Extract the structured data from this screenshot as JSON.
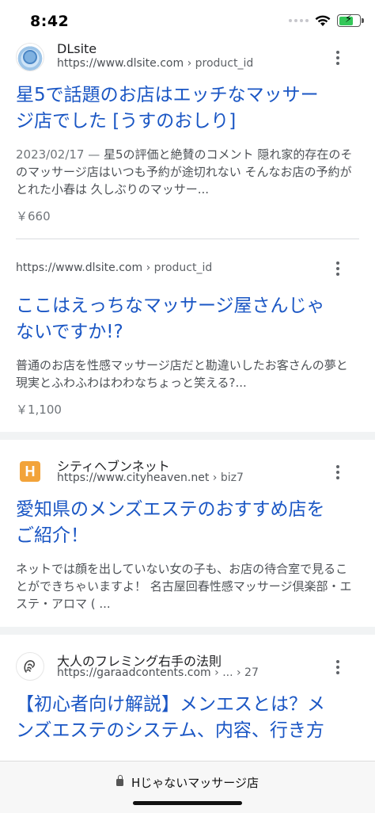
{
  "status": {
    "time": "8:42"
  },
  "results": [
    {
      "site_name": "DLsite",
      "url_domain": "https://www.dlsite.com",
      "url_path": " › product_id",
      "title_line1": "星5で話題のお店はエッチなマッサー",
      "title_line2": "ジ店でした [うすのおしり]",
      "date": "2023/02/17 — ",
      "snippet": "星5の評価と絶賛のコメント 隠れ家的存在のそのマッサージ店はいつも予約が途切れない そんなお店の予約がとれた小春は 久しぶりのマッサー...",
      "price": "￥660"
    },
    {
      "url_domain": "https://www.dlsite.com",
      "url_path": " › product_id",
      "title_line1": "ここはえっちなマッサージ屋さんじゃ",
      "title_line2": "ないですか!?",
      "snippet": "普通のお店を性感マッサージ店だと勘違いしたお客さんの夢と現実とふわふわはわわなちょっと笑える?...",
      "price": "￥1,100"
    },
    {
      "site_name": "シティヘブンネット",
      "url_domain": "https://www.cityheaven.net",
      "url_path": " › biz7",
      "title_line1": "愛知県のメンズエステのおすすめ店を",
      "title_line2": "ご紹介！",
      "snippet": "ネットでは顔を出していない女の子も、お店の待合室で見ることができちゃいますよ！ 名古屋回春性感マッサージ倶楽部・エステ・アロマ ( ..."
    },
    {
      "site_name": "大人のフレミング右手の法則",
      "url_domain": "https://garaadcontents.com",
      "url_path": " › ... › 27",
      "title_line1": "【初心者向け解説】メンエスとは？メ",
      "title_line2": "ンズエステのシステム、内容、行き方"
    }
  ],
  "browser": {
    "address": "Hじゃないマッサージ店"
  },
  "icons": {
    "signal": "cellular-signal-icon",
    "wifi": "wifi-icon",
    "battery": "battery-charging-icon",
    "lock": "lock-icon",
    "more": "more-vert-icon"
  },
  "colors": {
    "link": "#1a56c4",
    "battery": "#34c759"
  }
}
